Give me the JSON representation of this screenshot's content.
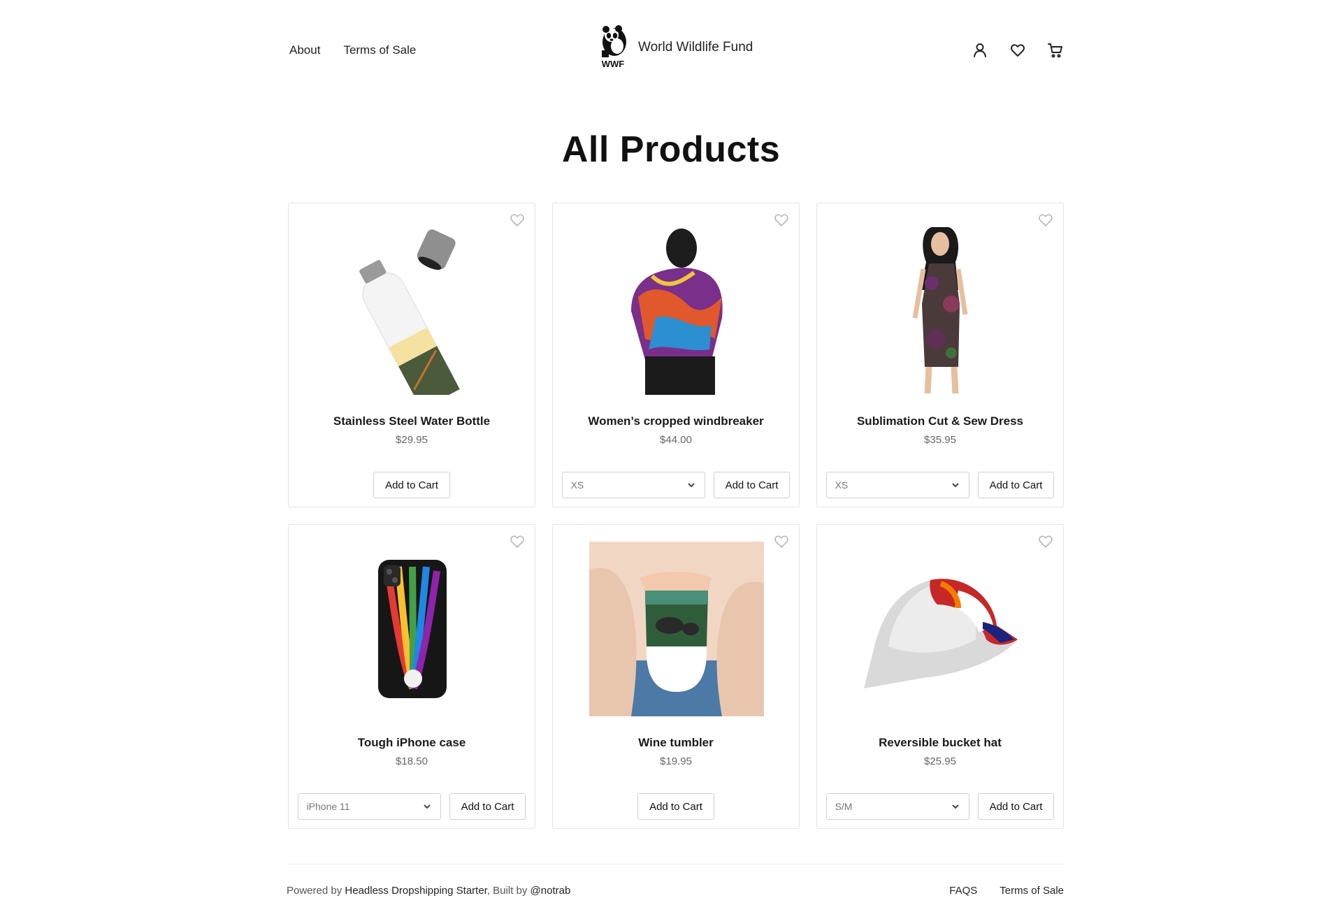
{
  "header": {
    "nav_left": [
      {
        "label": "About"
      },
      {
        "label": "Terms of Sale"
      }
    ],
    "brand": {
      "logo_text": "WWF",
      "name": "World Wildlife Fund"
    },
    "icons": [
      "user-icon",
      "heart-icon",
      "cart-icon"
    ]
  },
  "main": {
    "title": "All Products",
    "products": [
      {
        "name": "Stainless Steel Water Bottle",
        "price": "$29.95",
        "variant": null,
        "add_label": "Add to Cart"
      },
      {
        "name": "Women’s cropped windbreaker",
        "price": "$44.00",
        "variant": "XS",
        "add_label": "Add to Cart"
      },
      {
        "name": "Sublimation Cut & Sew Dress",
        "price": "$35.95",
        "variant": "XS",
        "add_label": "Add to Cart"
      },
      {
        "name": "Tough iPhone case",
        "price": "$18.50",
        "variant": "iPhone 11",
        "add_label": "Add to Cart"
      },
      {
        "name": "Wine tumbler",
        "price": "$19.95",
        "variant": null,
        "add_label": "Add to Cart"
      },
      {
        "name": "Reversible bucket hat",
        "price": "$25.95",
        "variant": "S/M",
        "add_label": "Add to Cart"
      }
    ]
  },
  "footer": {
    "powered_prefix": "Powered by",
    "powered_link": "Headless Dropshipping Starter",
    "built_prefix": ", Built by",
    "built_link": "@notrab",
    "links": [
      {
        "label": "FAQS"
      },
      {
        "label": "Terms of Sale"
      }
    ]
  },
  "colors": {
    "card_border": "#e3e3e3",
    "text": "#111111",
    "muted": "#666666"
  }
}
